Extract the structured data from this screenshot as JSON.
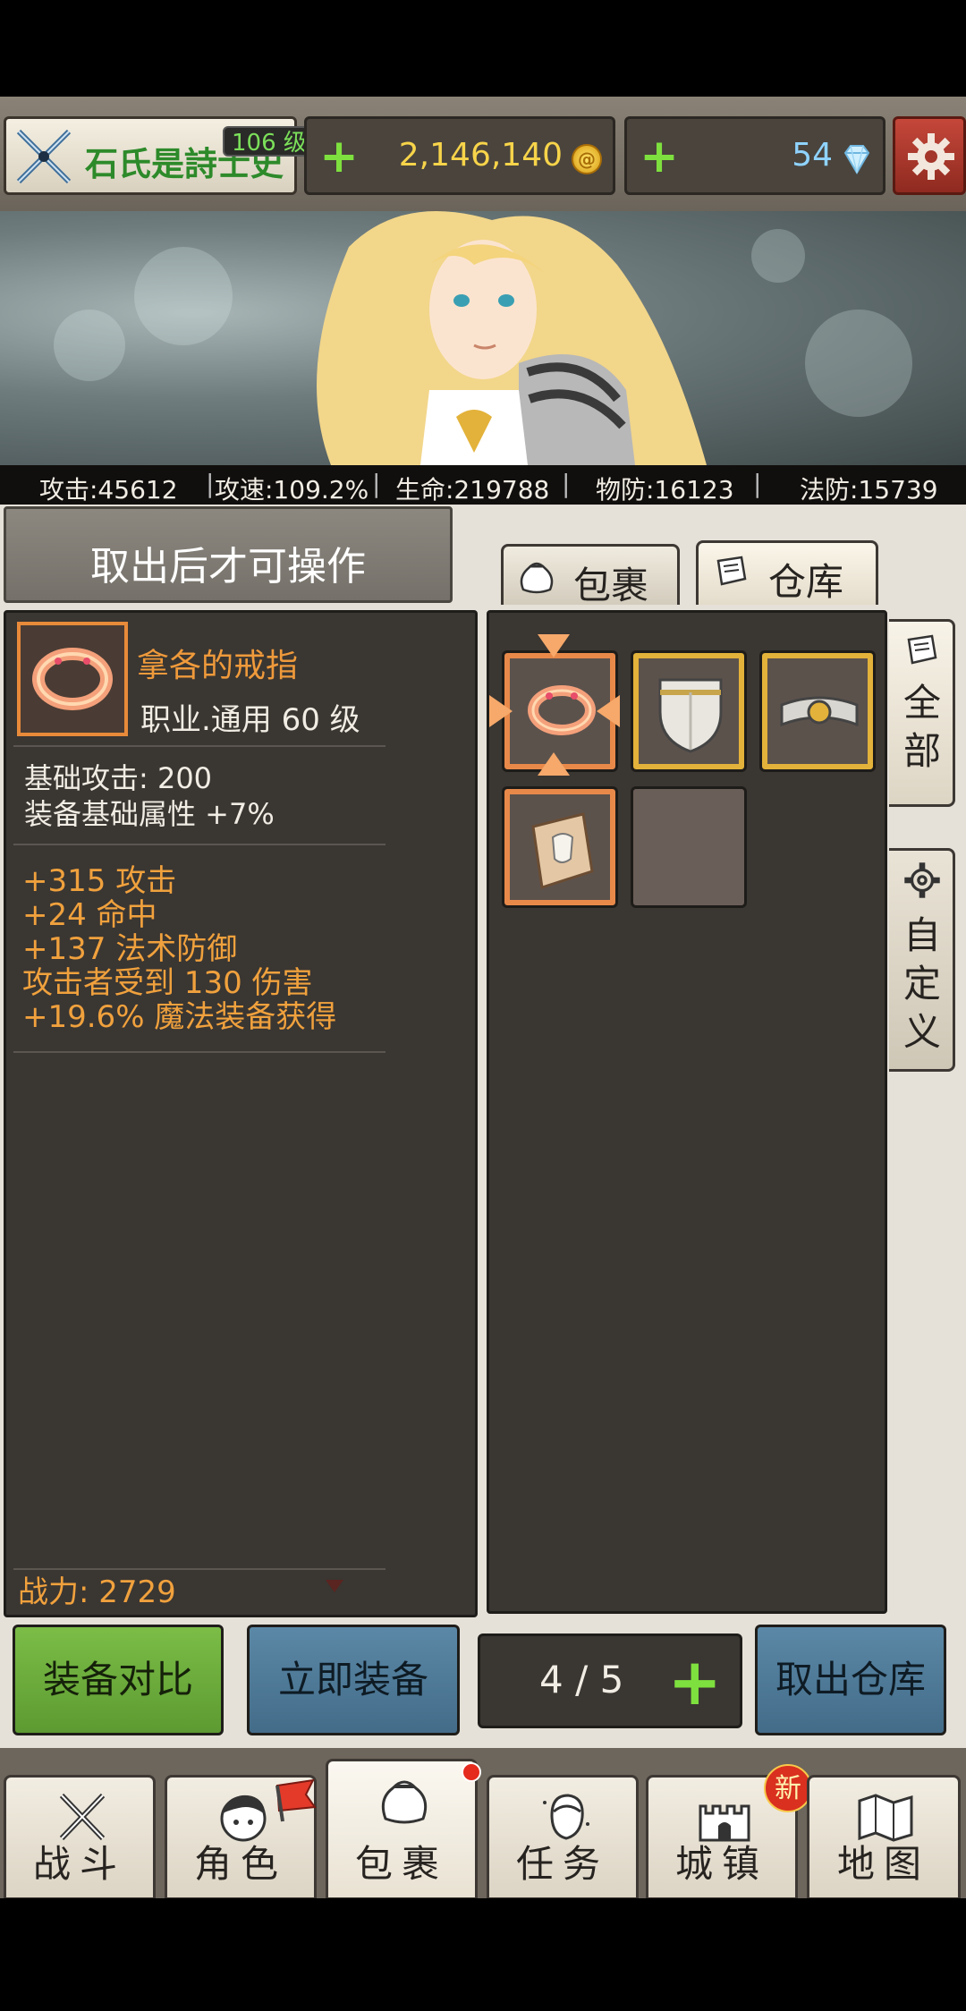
{
  "player": {
    "name": "石氏是詩士史",
    "level": "106 级"
  },
  "currency": {
    "gold": "2,146,140",
    "gems": "54"
  },
  "stats": {
    "attack": "攻击:45612",
    "attack_speed": "攻速:109.2%",
    "hp": "生命:219788",
    "phys_def": "物防:16123",
    "magic_def": "法防:15739"
  },
  "notice": "取出后才可操作",
  "tabs": {
    "bag": "包裹",
    "storage": "仓库"
  },
  "side_tabs": {
    "all": [
      "全",
      "部"
    ],
    "custom": [
      "自",
      "定",
      "义"
    ]
  },
  "item": {
    "name": "拿各的戒指",
    "class_level": "职业.通用   60 级",
    "base_attack": "基础攻击: 200",
    "base_attr": "装备基础属性 +7%",
    "bonuses": [
      "+315 攻击",
      "+24 命中",
      "+137 法术防御",
      "攻击者受到 130 伤害",
      "+19.6% 魔法装备获得"
    ],
    "power": "战力: 2729"
  },
  "inventory": [
    {
      "icon": "ring-icon",
      "frame": "orange",
      "selected": true
    },
    {
      "icon": "shield-icon",
      "frame": "gold"
    },
    {
      "icon": "belt-icon",
      "frame": "gold"
    },
    {
      "icon": "scroll-icon",
      "frame": "orange"
    },
    {
      "icon": "",
      "frame": "empty"
    }
  ],
  "buttons": {
    "compare": "装备对比",
    "equip": "立即装备",
    "page": "4 / 5",
    "withdraw": "取出仓库"
  },
  "nav": [
    {
      "label": "战斗",
      "icon": "crossed-swords-icon"
    },
    {
      "label": "角色",
      "icon": "character-icon"
    },
    {
      "label": "包裹",
      "icon": "bag-icon"
    },
    {
      "label": "任务",
      "icon": "quest-icon"
    },
    {
      "label": "城镇",
      "icon": "castle-icon"
    },
    {
      "label": "地图",
      "icon": "map-icon"
    }
  ],
  "badges": {
    "town_new": "新"
  },
  "colors": {
    "accent_orange": "#e8894a",
    "gold": "#e3b23a",
    "green": "#7ee03e",
    "gold_text": "#f7d44a"
  }
}
